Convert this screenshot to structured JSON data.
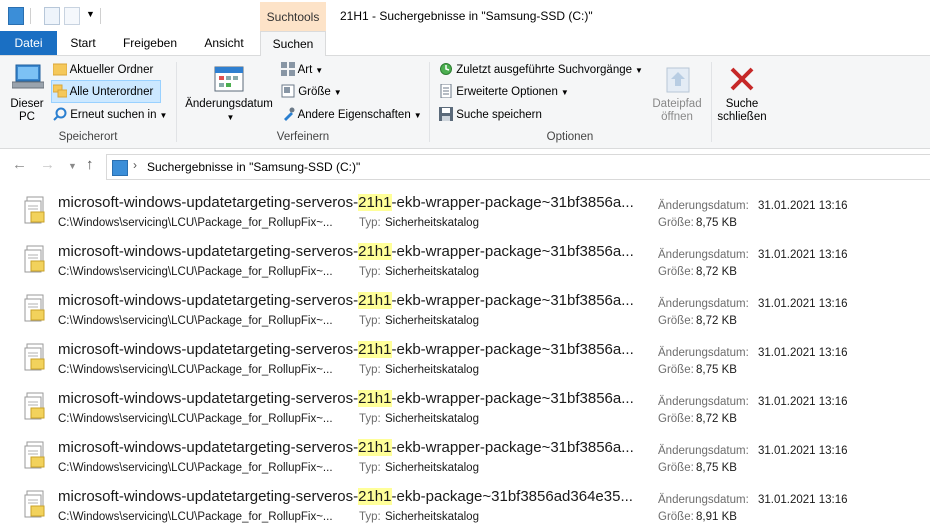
{
  "window": {
    "title": "21H1 - Suchergebnisse in \"Samsung-SSD (C:)\"",
    "context_tab": "Suchtools"
  },
  "tabs": [
    {
      "label": "Datei"
    },
    {
      "label": "Start"
    },
    {
      "label": "Freigeben"
    },
    {
      "label": "Ansicht"
    },
    {
      "label": "Suchen"
    }
  ],
  "ribbon": {
    "speicherort": {
      "label": "Speicherort",
      "dieser_pc": "Dieser PC",
      "aktueller_ordner": "Aktueller Ordner",
      "alle_unterordner": "Alle Unterordner",
      "erneut_suchen": "Erneut suchen in"
    },
    "verfeinern": {
      "label": "Verfeinern",
      "aenderungsdatum": "Änderungsdatum",
      "art": "Art",
      "groesse": "Größe",
      "andere": "Andere Eigenschaften"
    },
    "optionen": {
      "label": "Optionen",
      "zuletzt": "Zuletzt ausgeführte Suchvorgänge",
      "erweitert": "Erweiterte Optionen",
      "speichern": "Suche speichern",
      "dateipfad_1": "Dateipfad",
      "dateipfad_2": "öffnen",
      "schliessen_1": "Suche",
      "schliessen_2": "schließen"
    }
  },
  "address": {
    "path": "Suchergebnisse in \"Samsung-SSD (C:)\""
  },
  "labels": {
    "type": "Typ:",
    "modified": "Änderungsdatum:",
    "size": "Größe:"
  },
  "results": [
    {
      "name_pre": "microsoft-windows-updatetargeting-serveros-",
      "name_hl": "21h1",
      "name_post": "-ekb-wrapper-package~31bf3856a...",
      "path": "C:\\Windows\\servicing\\LCU\\Package_for_RollupFix~...",
      "type": "Sicherheitskatalog",
      "modified": "31.01.2021 13:16",
      "size": "8,75 KB"
    },
    {
      "name_pre": "microsoft-windows-updatetargeting-serveros-",
      "name_hl": "21h1",
      "name_post": "-ekb-wrapper-package~31bf3856a...",
      "path": "C:\\Windows\\servicing\\LCU\\Package_for_RollupFix~...",
      "type": "Sicherheitskatalog",
      "modified": "31.01.2021 13:16",
      "size": "8,72 KB"
    },
    {
      "name_pre": "microsoft-windows-updatetargeting-serveros-",
      "name_hl": "21h1",
      "name_post": "-ekb-wrapper-package~31bf3856a...",
      "path": "C:\\Windows\\servicing\\LCU\\Package_for_RollupFix~...",
      "type": "Sicherheitskatalog",
      "modified": "31.01.2021 13:16",
      "size": "8,72 KB"
    },
    {
      "name_pre": "microsoft-windows-updatetargeting-serveros-",
      "name_hl": "21h1",
      "name_post": "-ekb-wrapper-package~31bf3856a...",
      "path": "C:\\Windows\\servicing\\LCU\\Package_for_RollupFix~...",
      "type": "Sicherheitskatalog",
      "modified": "31.01.2021 13:16",
      "size": "8,75 KB"
    },
    {
      "name_pre": "microsoft-windows-updatetargeting-serveros-",
      "name_hl": "21h1",
      "name_post": "-ekb-wrapper-package~31bf3856a...",
      "path": "C:\\Windows\\servicing\\LCU\\Package_for_RollupFix~...",
      "type": "Sicherheitskatalog",
      "modified": "31.01.2021 13:16",
      "size": "8,72 KB"
    },
    {
      "name_pre": "microsoft-windows-updatetargeting-serveros-",
      "name_hl": "21h1",
      "name_post": "-ekb-wrapper-package~31bf3856a...",
      "path": "C:\\Windows\\servicing\\LCU\\Package_for_RollupFix~...",
      "type": "Sicherheitskatalog",
      "modified": "31.01.2021 13:16",
      "size": "8,75 KB"
    },
    {
      "name_pre": "microsoft-windows-updatetargeting-serveros-",
      "name_hl": "21h1",
      "name_post": "-ekb-package~31bf3856ad364e35...",
      "path": "C:\\Windows\\servicing\\LCU\\Package_for_RollupFix~...",
      "type": "Sicherheitskatalog",
      "modified": "31.01.2021 13:16",
      "size": "8,91 KB"
    }
  ],
  "colors": {
    "file_tab": "#1a6fc3",
    "context_tab": "#fde3c8",
    "highlight": "#ffff99",
    "selected": "#cce8ff"
  }
}
